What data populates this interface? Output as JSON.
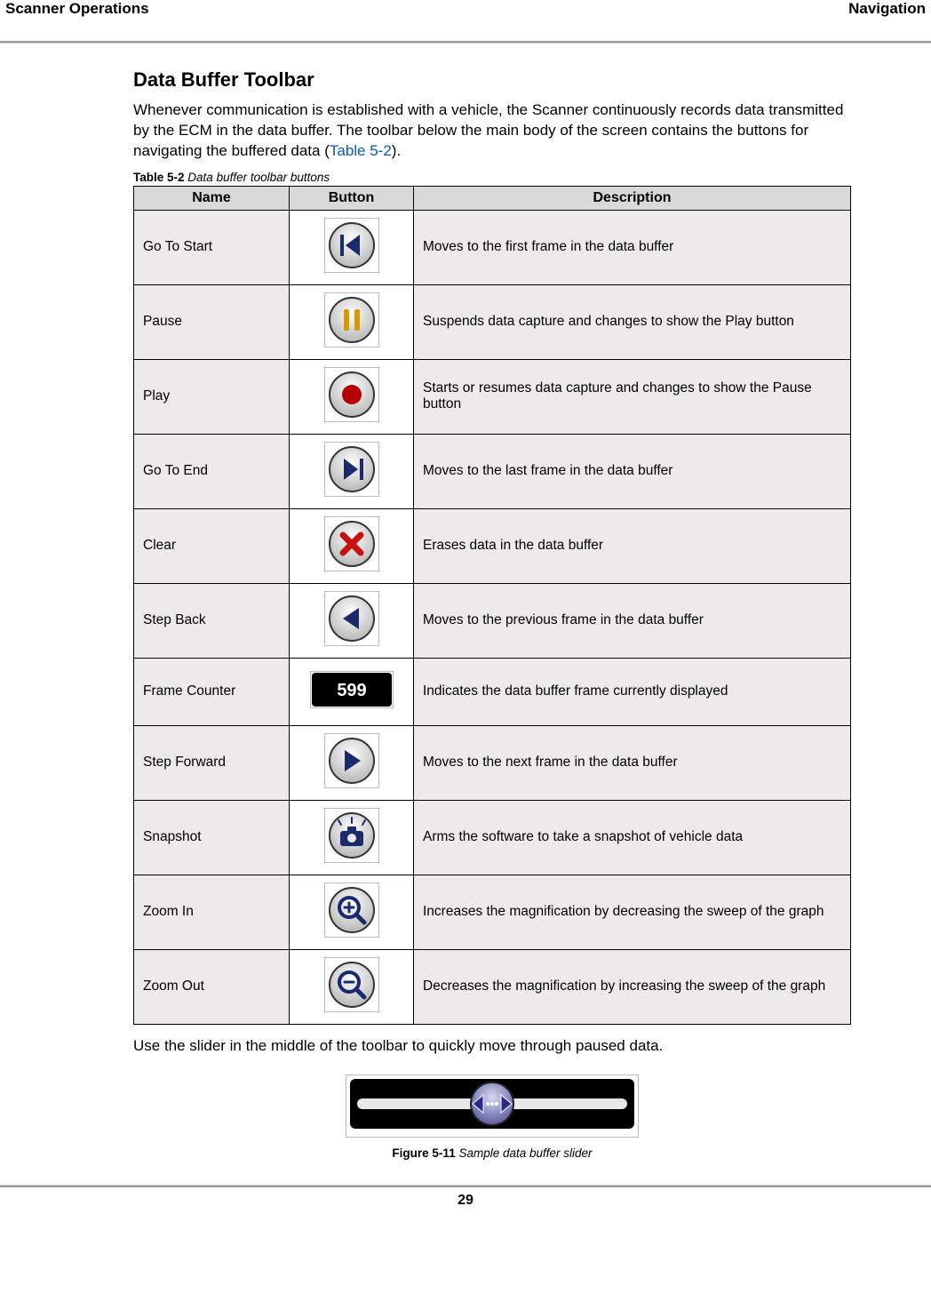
{
  "header": {
    "left": "Scanner Operations",
    "right": "Navigation"
  },
  "section_title": "Data Buffer Toolbar",
  "intro_text_1": "Whenever communication is established with a vehicle, the Scanner continuously records data transmitted by the ECM in the data buffer. The toolbar below the main body of the screen contains the buttons for navigating the buffered data (",
  "intro_link": "Table 5-2",
  "intro_text_2": ").",
  "table_caption_label": "Table 5-2",
  "table_caption_text": "Data buffer toolbar buttons",
  "table_headers": {
    "name": "Name",
    "button": "Button",
    "description": "Description"
  },
  "rows": [
    {
      "name": "Go To Start",
      "icon": "go-to-start",
      "desc": "Moves to the first frame in the data buffer"
    },
    {
      "name": "Pause",
      "icon": "pause",
      "desc": "Suspends data capture and changes to show the Play button"
    },
    {
      "name": "Play",
      "icon": "record",
      "desc": "Starts or resumes data capture and changes to show the Pause button"
    },
    {
      "name": "Go To End",
      "icon": "go-to-end",
      "desc": "Moves to the last frame in the data buffer"
    },
    {
      "name": "Clear",
      "icon": "clear",
      "desc": "Erases data in the data buffer"
    },
    {
      "name": "Step Back",
      "icon": "step-back",
      "desc": "Moves to the previous frame in the data buffer"
    },
    {
      "name": "Frame Counter",
      "icon": "frame-counter",
      "desc": "Indicates the data buffer frame currently displayed"
    },
    {
      "name": "Step Forward",
      "icon": "step-forward",
      "desc": "Moves to the next frame in the data buffer"
    },
    {
      "name": "Snapshot",
      "icon": "snapshot",
      "desc": "Arms the software to take a snapshot of vehicle data"
    },
    {
      "name": "Zoom In",
      "icon": "zoom-in",
      "desc": "Increases the magnification by decreasing the sweep of the graph"
    },
    {
      "name": "Zoom Out",
      "icon": "zoom-out",
      "desc": "Decreases the magnification by increasing the sweep of the graph"
    }
  ],
  "frame_counter_value": "599",
  "slider_text": "Use the slider in the middle of the toolbar to quickly move through paused data.",
  "figure_caption_label": "Figure 5-11",
  "figure_caption_text": "Sample data buffer slider",
  "page_number": "29"
}
